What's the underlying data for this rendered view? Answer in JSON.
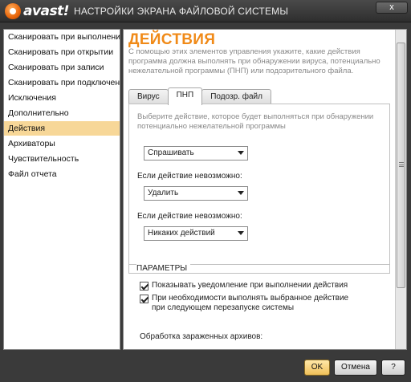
{
  "app": {
    "logo_text": "avast!",
    "title": "НАСТРОЙКИ ЭКРАНА ФАЙЛОВОЙ СИСТЕМЫ",
    "close_label": "x"
  },
  "sidebar": {
    "items": [
      {
        "label": "Сканировать при выполнении"
      },
      {
        "label": "Сканировать при открытии"
      },
      {
        "label": "Сканировать при записи"
      },
      {
        "label": "Сканировать при подключении"
      },
      {
        "label": "Исключения"
      },
      {
        "label": "Дополнительно"
      },
      {
        "label": "Действия"
      },
      {
        "label": "Архиваторы"
      },
      {
        "label": "Чувствительность"
      },
      {
        "label": "Файл отчета"
      }
    ],
    "active_index": 6
  },
  "main": {
    "heading": "ДЕЙСТВИЯ",
    "description": "С помощью этих элементов управления укажите, какие действия программа должна выполнять при обнаружении вируса, потенциально нежелательной программы (ПНП) или подозрительного файла.",
    "tabs": [
      {
        "label": "Вирус"
      },
      {
        "label": "ПНП"
      },
      {
        "label": "Подозр. файл"
      }
    ],
    "active_tab": 1,
    "pane": {
      "description": "Выберите действие, которое будет выполняться при обнаружении потенциально нежелательной программы",
      "select1_value": "Спрашивать",
      "label2": "Если действие невозможно:",
      "select2_value": "Удалить",
      "label3": "Если действие невозможно:",
      "select3_value": "Никаких действий"
    },
    "params": {
      "title": "ПАРАМЕТРЫ",
      "check1_label": "Показывать уведомление при выполнении действия",
      "check1_checked": true,
      "check2_label": "При необходимости выполнять выбранное действие при следующем перезапуске системы",
      "check2_checked": true,
      "archives_label": "Обработка зараженных архивов:"
    }
  },
  "buttons": {
    "ok": "OK",
    "cancel": "Отмена",
    "help": "?"
  }
}
